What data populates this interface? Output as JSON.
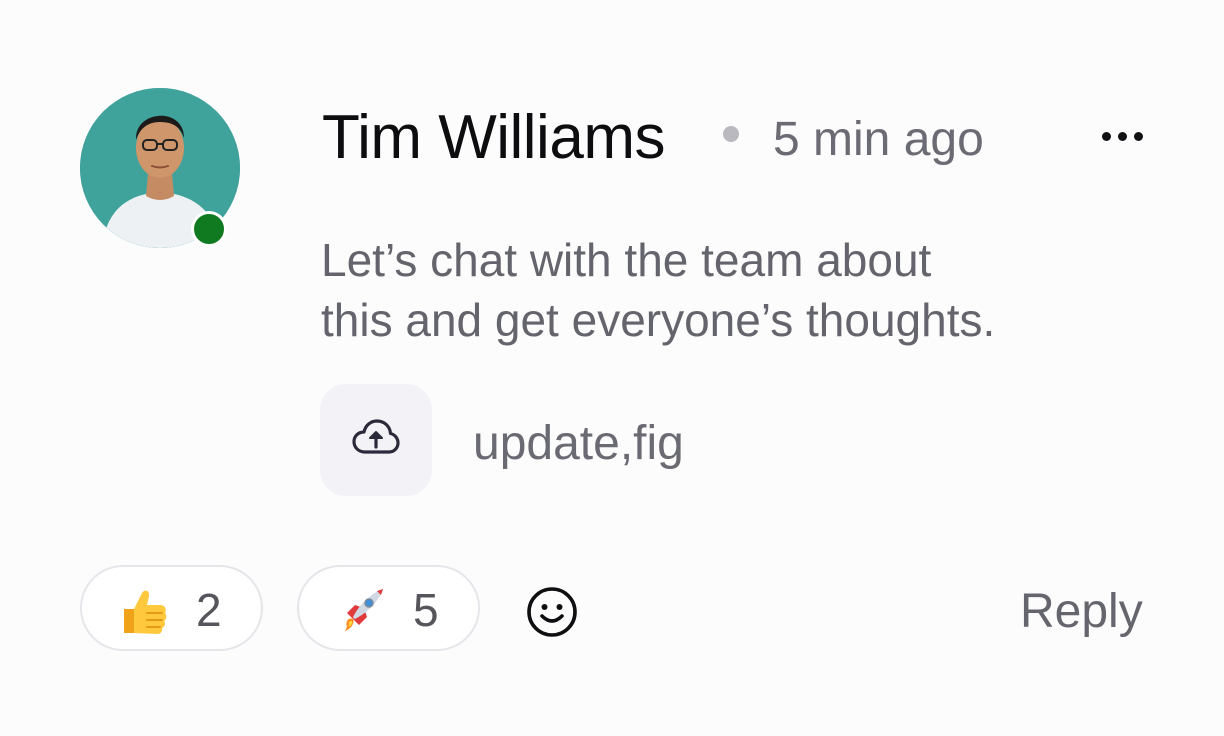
{
  "comment": {
    "author": "Tim Williams",
    "time": "5 min ago",
    "online": true,
    "message_lines": [
      "Let’s chat with the team about",
      "this and get everyone’s thoughts."
    ],
    "attachment": {
      "name": "update,fig",
      "icon": "cloud-upload-icon"
    },
    "reactions": [
      {
        "icon": "thumbs-up-emoji",
        "count": "2"
      },
      {
        "icon": "rocket-emoji",
        "count": "5"
      }
    ],
    "add_reaction_icon": "smiley-icon",
    "reply_label": "Reply",
    "more_icon": "more-horizontal-icon"
  },
  "colors": {
    "presence": "#0f7a1f",
    "avatar_background": "#3fa39b",
    "author": "#0d0d10",
    "muted_text": "#64646c"
  }
}
